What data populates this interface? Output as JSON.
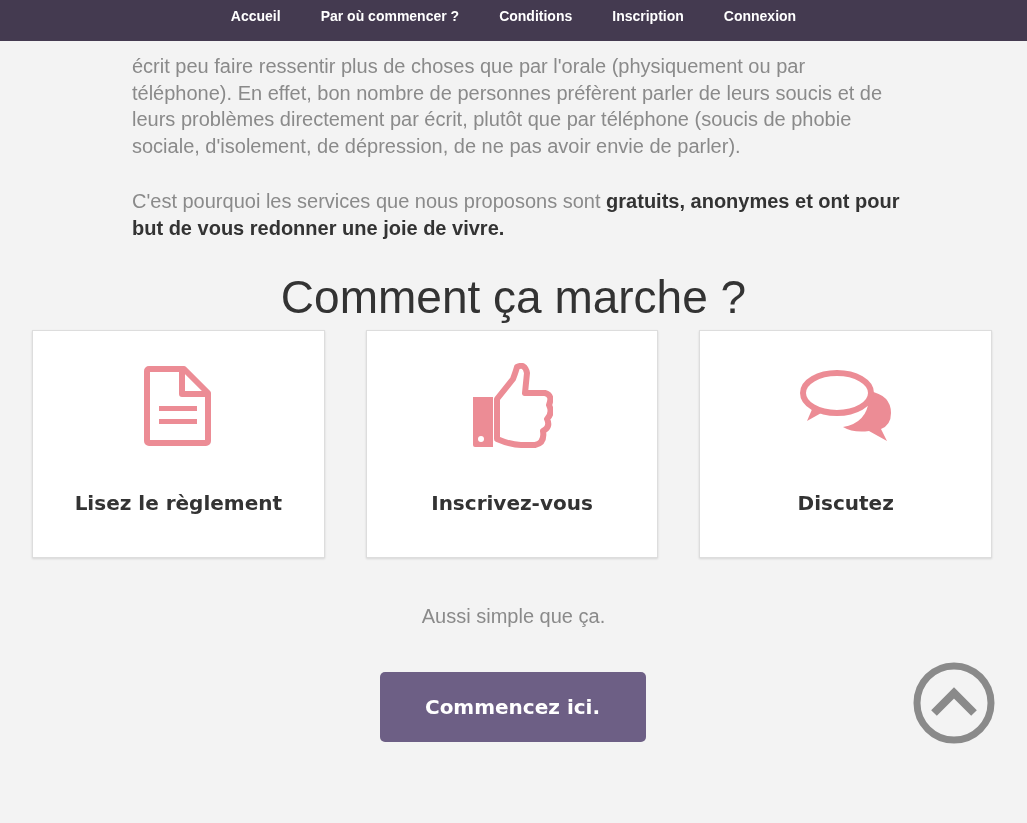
{
  "nav": [
    "Accueil",
    "Par où commencer ?",
    "Conditions",
    "Inscription",
    "Connexion"
  ],
  "paragraphs": [
    "écrit peu faire ressentir plus de choses que par l'orale (physiquement ou par téléphone). En effet, bon nombre de personnes préfèrent parler de leurs soucis et de leurs problèmes directement par écrit, plutôt que par téléphone (soucis de phobie sociale, d'isolement, de dépression, de ne pas avoir envie de parler).",
    "C'est pourquoi les services que nous proposons sont **gratuits, anonymes et ont pour but de vous redonner une joie de vivre.**"
  ],
  "heading": "Comment ça marche ?",
  "cards": [
    {
      "kind": "document",
      "label": "Lisez le règlement"
    },
    {
      "kind": "thumb",
      "label": "Inscrivez-vous"
    },
    {
      "kind": "chat",
      "label": "Discutez"
    }
  ],
  "caption": "Aussi simple que ça.",
  "button": "Commencez ici."
}
